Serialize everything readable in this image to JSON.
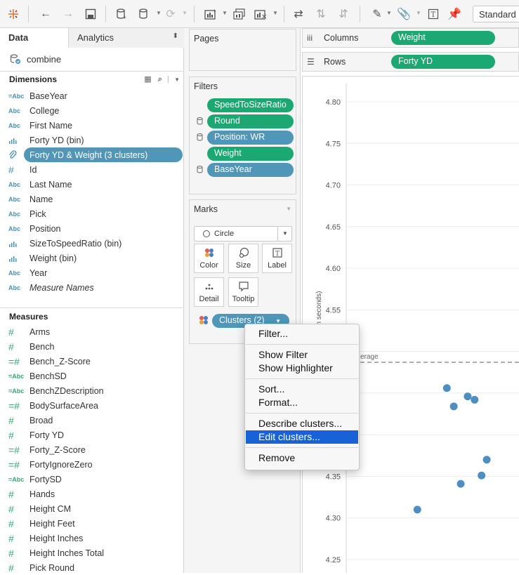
{
  "toolbar": {
    "view_mode": "Standard"
  },
  "tabs": {
    "data": "Data",
    "analytics": "Analytics"
  },
  "datasource": "combine",
  "dimensions": {
    "header": "Dimensions",
    "items": [
      {
        "label": "BaseYear",
        "icon": "=Abc"
      },
      {
        "label": "College",
        "icon": "Abc"
      },
      {
        "label": "First Name",
        "icon": "Abc"
      },
      {
        "label": "Forty YD (bin)",
        "icon": "bin-icon"
      },
      {
        "label": "Forty YD & Weight (3 clusters)",
        "icon": "paperclip-icon"
      },
      {
        "label": "Id",
        "icon": "#"
      },
      {
        "label": "Last Name",
        "icon": "Abc"
      },
      {
        "label": "Name",
        "icon": "Abc"
      },
      {
        "label": "Pick",
        "icon": "Abc"
      },
      {
        "label": "Position",
        "icon": "Abc"
      },
      {
        "label": "SizeToSpeedRatio (bin)",
        "icon": "bin-icon"
      },
      {
        "label": "Weight (bin)",
        "icon": "bin-icon"
      },
      {
        "label": "Year",
        "icon": "Abc"
      },
      {
        "label": "Measure Names",
        "icon": "Abc"
      }
    ]
  },
  "measures": {
    "header": "Measures",
    "items": [
      {
        "label": "Arms",
        "icon": "#"
      },
      {
        "label": "Bench",
        "icon": "#"
      },
      {
        "label": "Bench_Z-Score",
        "icon": "=#"
      },
      {
        "label": "BenchSD",
        "icon": "=Abc"
      },
      {
        "label": "BenchZDescription",
        "icon": "=Abc"
      },
      {
        "label": "BodySurfaceArea",
        "icon": "=#"
      },
      {
        "label": "Broad",
        "icon": "#"
      },
      {
        "label": "Forty YD",
        "icon": "#"
      },
      {
        "label": "Forty_Z-Score",
        "icon": "=#"
      },
      {
        "label": "FortyIgnoreZero",
        "icon": "=#"
      },
      {
        "label": "FortySD",
        "icon": "=Abc"
      },
      {
        "label": "Hands",
        "icon": "#"
      },
      {
        "label": "Height CM",
        "icon": "#"
      },
      {
        "label": "Height Feet",
        "icon": "#"
      },
      {
        "label": "Height Inches",
        "icon": "#"
      },
      {
        "label": "Height Inches Total",
        "icon": "#"
      },
      {
        "label": "Pick Round",
        "icon": "#"
      }
    ]
  },
  "pages": {
    "title": "Pages"
  },
  "filters": {
    "title": "Filters",
    "items": [
      {
        "label": "SpeedToSizeRatio",
        "color": "green",
        "context": false
      },
      {
        "label": "Round",
        "color": "green",
        "context": true
      },
      {
        "label": "Position: WR",
        "color": "blue",
        "context": true
      },
      {
        "label": "Weight",
        "color": "green",
        "context": false
      },
      {
        "label": "BaseYear",
        "color": "blue",
        "context": true
      }
    ]
  },
  "marks": {
    "title": "Marks",
    "type": "Circle",
    "buttons": [
      "Color",
      "Size",
      "Label",
      "Detail",
      "Tooltip"
    ],
    "pill": "Clusters (2)"
  },
  "shelves": {
    "columns_label": "Columns",
    "columns_pill": "Weight",
    "rows_label": "Rows",
    "rows_pill": "Forty YD"
  },
  "chart_data": {
    "type": "scatter",
    "ylabel": "n seconds)",
    "ylim": [
      4.25,
      4.8
    ],
    "yticks": [
      "4.80",
      "4.75",
      "4.70",
      "4.65",
      "4.60",
      "4.55",
      "4.50",
      "4.45",
      "4.40",
      "4.35",
      "4.30",
      "4.25"
    ],
    "reference_line": {
      "label": "erage",
      "value": 4.487
    },
    "point_color": "#4f8fc0",
    "points": [
      {
        "x": 0.41,
        "y": 4.31
      },
      {
        "x": 0.58,
        "y": 4.456
      },
      {
        "x": 0.62,
        "y": 4.434
      },
      {
        "x": 0.66,
        "y": 4.341
      },
      {
        "x": 0.7,
        "y": 4.446
      },
      {
        "x": 0.74,
        "y": 4.442
      },
      {
        "x": 0.78,
        "y": 4.351
      },
      {
        "x": 0.81,
        "y": 4.37
      }
    ]
  },
  "context_menu": {
    "groups": [
      [
        "Filter..."
      ],
      [
        "Show Filter",
        "Show Highlighter"
      ],
      [
        "Sort...",
        "Format..."
      ],
      [
        "Describe clusters...",
        "Edit clusters..."
      ],
      [
        "Remove"
      ]
    ],
    "highlighted": "Edit clusters..."
  }
}
